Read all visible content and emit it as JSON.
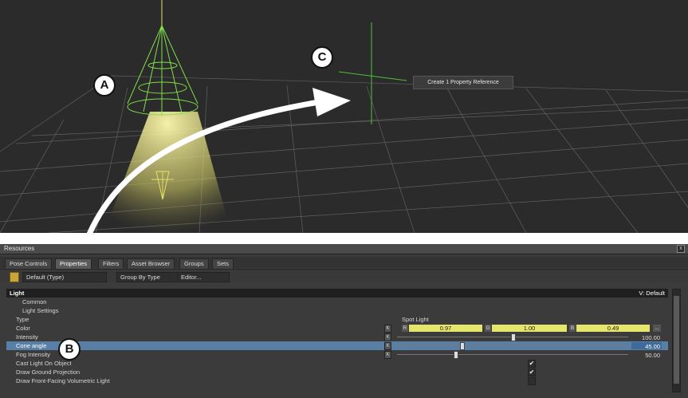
{
  "viewport": {
    "tooltip": "Create 1 Property Reference",
    "callouts": {
      "a": "A",
      "b": "B",
      "c": "C"
    }
  },
  "panel": {
    "title": "Resources",
    "close_label": "x",
    "tabs": [
      "Pose Controls",
      "Properties",
      "Filters",
      "Asset Browser",
      "Groups",
      "Sets"
    ],
    "active_tab": "Properties",
    "toolbar": {
      "filter_value": "Default (Type)",
      "group_value": "Group By Type",
      "editor_label": "Editor..."
    },
    "section": {
      "title": "Light",
      "version": "V: Default"
    },
    "groups": {
      "common": "Common",
      "light_settings": "Light Settings"
    },
    "rows": {
      "type": {
        "label": "Type",
        "value": "Spot Light"
      },
      "color": {
        "label": "Color",
        "r_label": "R",
        "r": "0.97",
        "g_label": "G",
        "g": "1.00",
        "b_label": "B",
        "b": "0.49",
        "more": "..."
      },
      "intensity": {
        "label": "Intensity",
        "value": "100.00",
        "fraction": 0.5
      },
      "cone_angle": {
        "label": "Cone angle",
        "value": "45.00",
        "fraction": 0.28
      },
      "fog_intensity": {
        "label": "Fog Intensity",
        "value": "50.00",
        "fraction": 0.25
      },
      "cast_light": {
        "label": "Cast Light On Object",
        "checked": true
      },
      "ground_projection": {
        "label": "Draw Ground Projection",
        "checked": true
      },
      "volumetric": {
        "label": "Draw Front-Facing Volumetric Light",
        "checked": false
      }
    },
    "k_label": "K",
    "check_glyph": "✔"
  }
}
